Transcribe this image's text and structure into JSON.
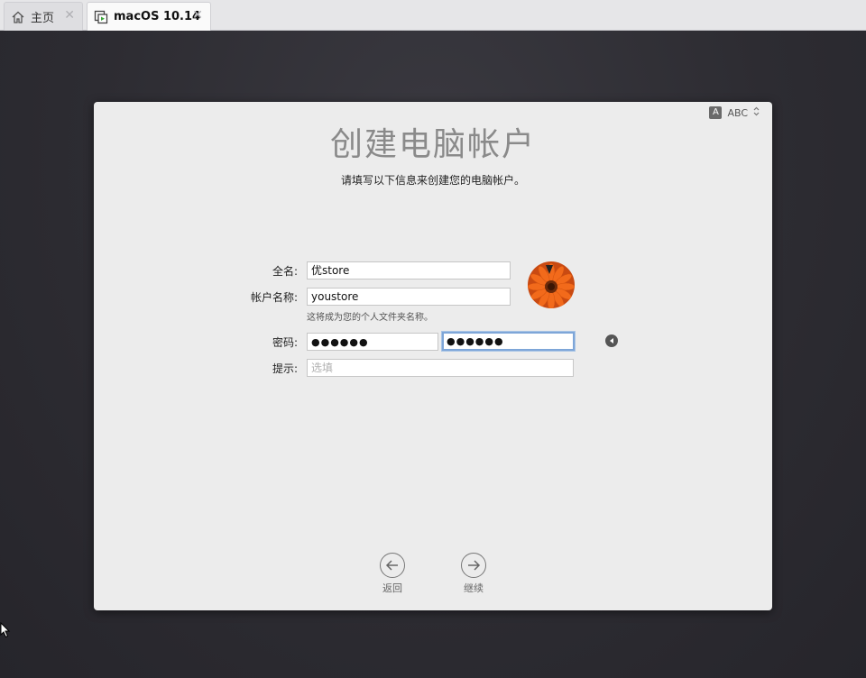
{
  "tabs": [
    {
      "label": "主页",
      "icon": "home-icon",
      "active": false
    },
    {
      "label": "macOS 10.14",
      "icon": "vm-icon",
      "active": true
    }
  ],
  "tab_close_glyph": "✕",
  "input_source": {
    "badge": "A",
    "label": "ABC",
    "icon": "chevron-updown-icon"
  },
  "setup": {
    "title": "创建电脑帐户",
    "subtitle": "请填写以下信息来创建您的电脑帐户。",
    "fullname_label": "全名:",
    "fullname_value": "优store",
    "account_label": "帐户名称:",
    "account_value": "youstore",
    "account_help": "这将成为您的个人文件夹名称。",
    "password_label": "密码:",
    "password_value": "●●●●●●",
    "password_verify_value": "●●●●●●",
    "hint_label": "提示:",
    "hint_placeholder": "选填",
    "back_label": "返回",
    "continue_label": "继续"
  },
  "colors": {
    "focus_ring": "#7ea6d8",
    "panel_bg": "#ececec",
    "avatar_orange": "#e85d1a"
  }
}
